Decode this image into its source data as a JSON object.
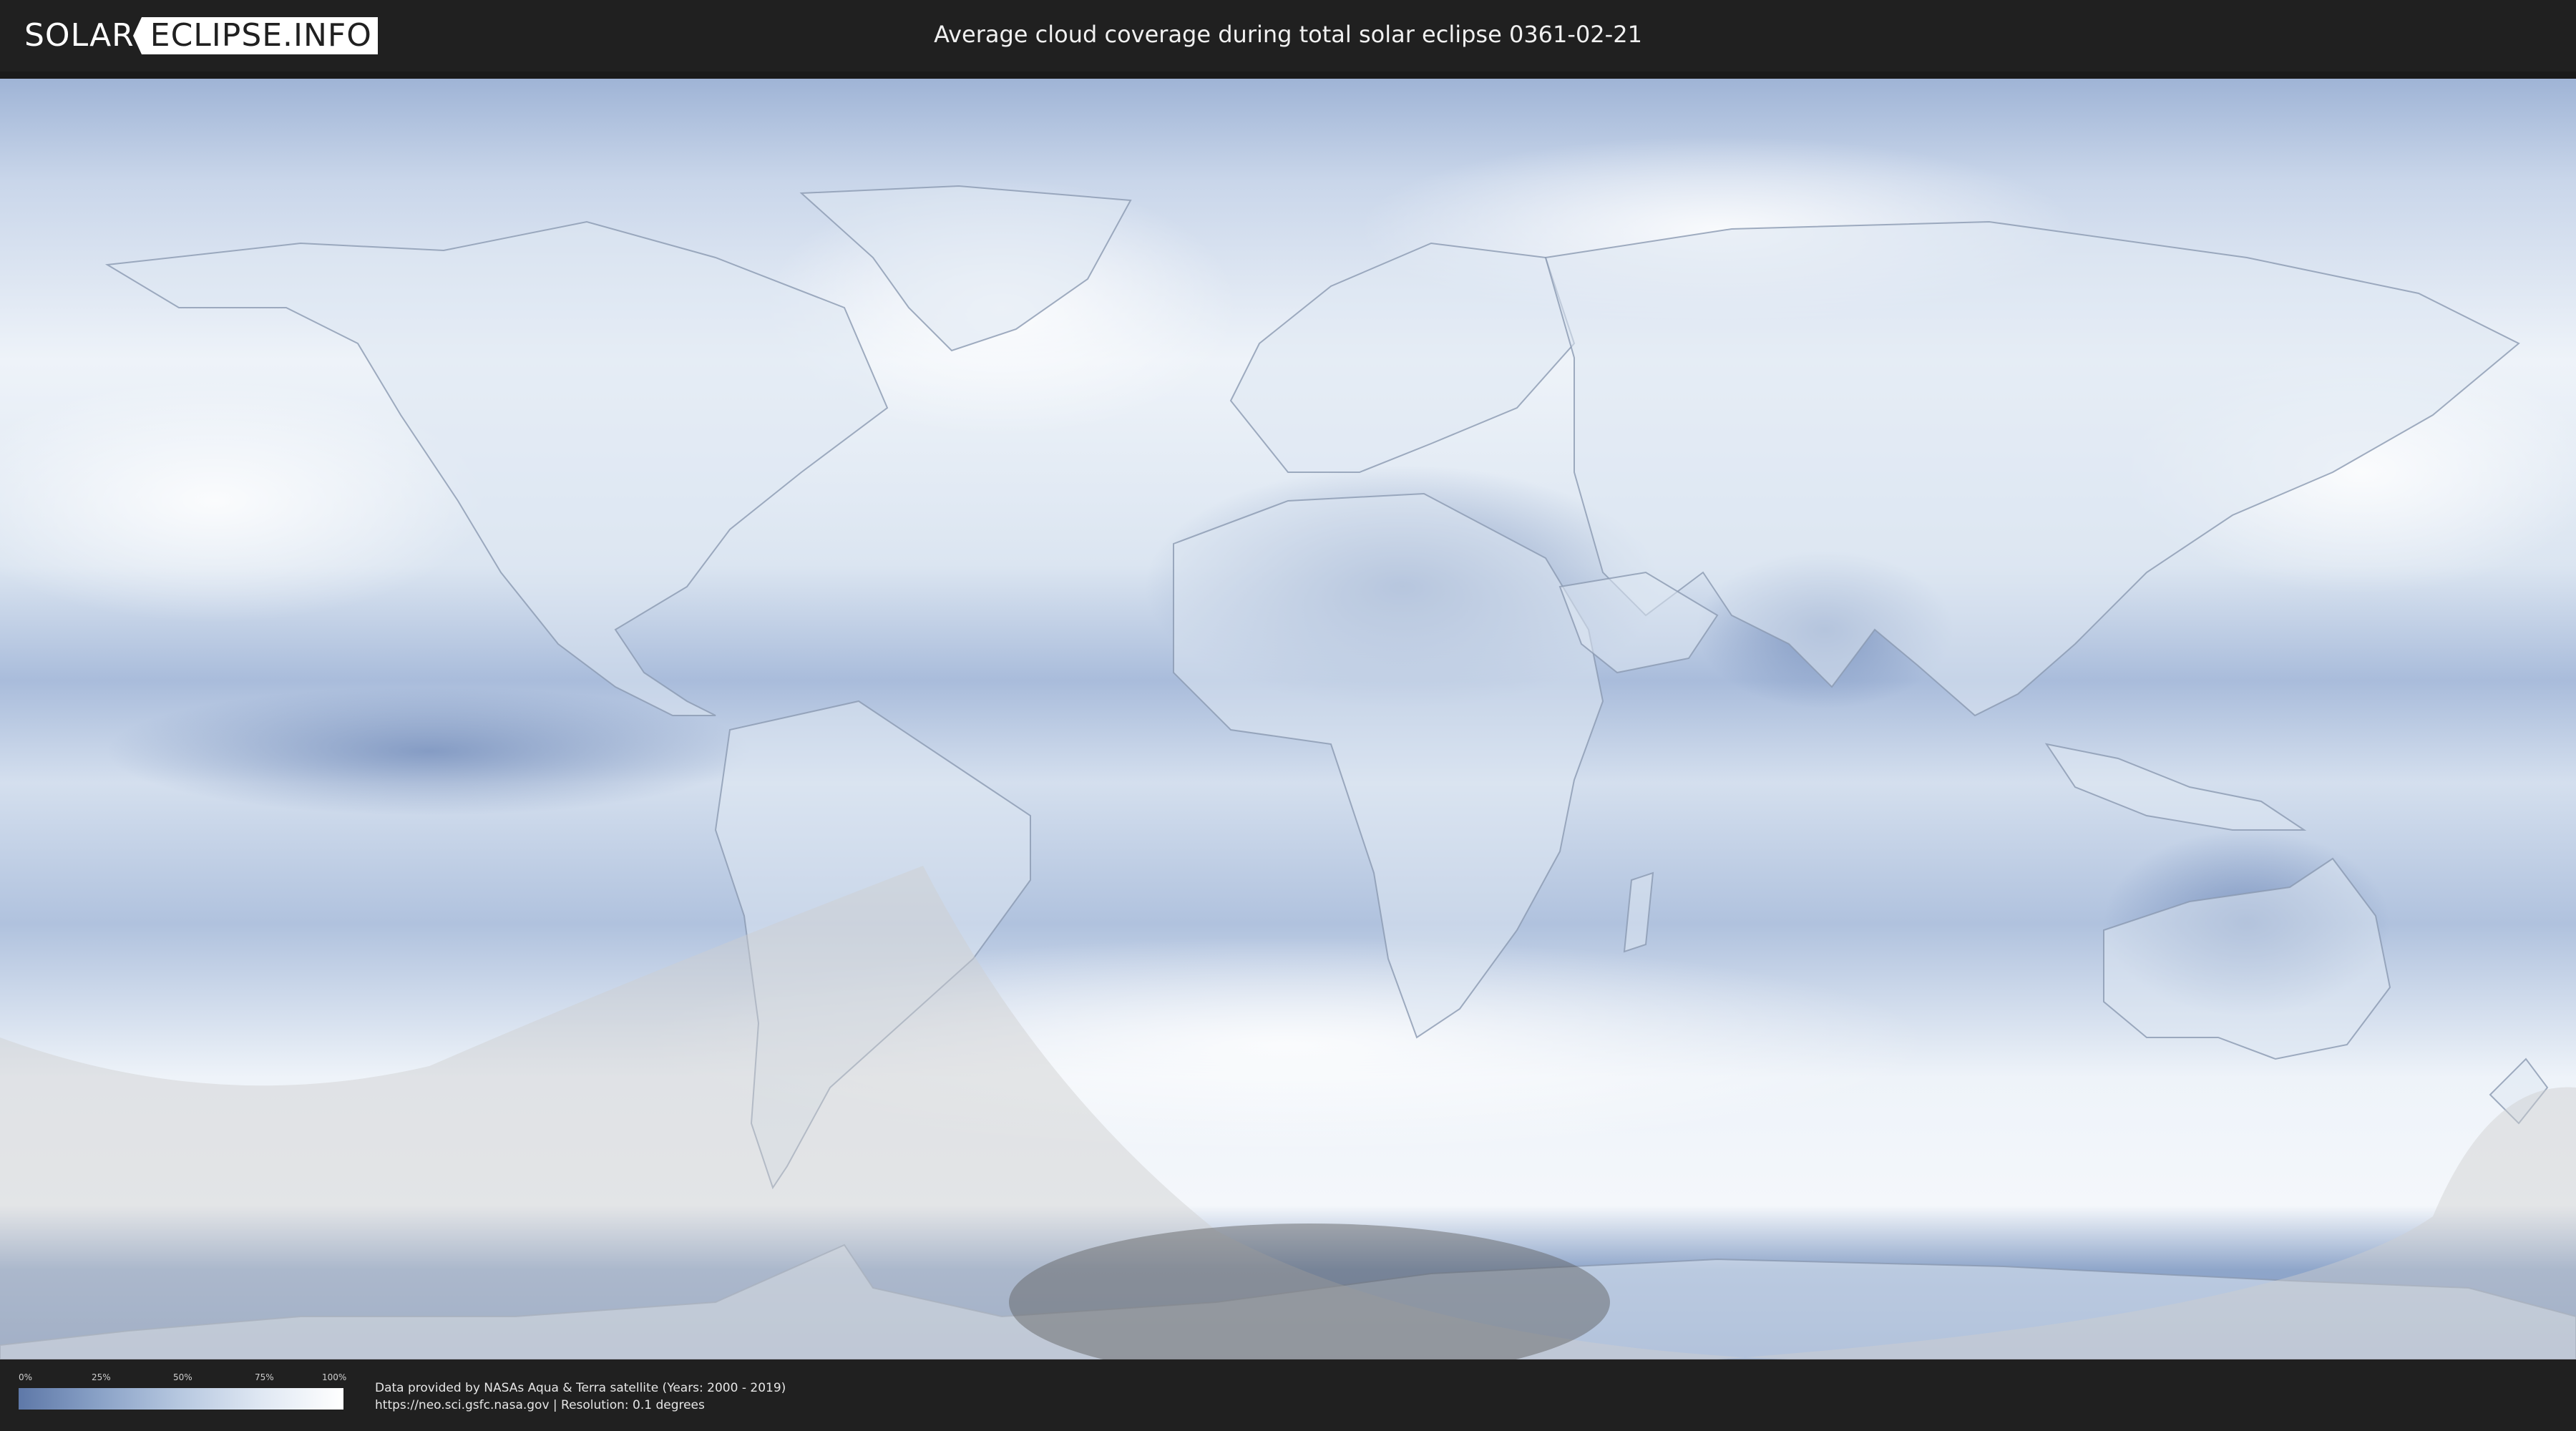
{
  "header": {
    "logo_left": "SOLAR",
    "logo_right": "ECLIPSE.INFO",
    "title": "Average cloud coverage during total solar eclipse 0361-02-21"
  },
  "map": {
    "colors": {
      "ocean_clear": "#6f89b8",
      "cloud_white": "#f4f7fb",
      "land_outline": "#8a98b0",
      "penumbra_shade": "#cfcfcf",
      "umbra_shade": "#5a5a5a"
    }
  },
  "legend": {
    "ticks": [
      "0%",
      "25%",
      "50%",
      "75%",
      "100%"
    ],
    "gradient_start": "#5e78a8",
    "gradient_end": "#ffffff"
  },
  "footer": {
    "credit_line1": "Data provided by NASAs Aqua & Terra satellite (Years: 2000 - 2019)",
    "credit_line2": "https://neo.sci.gsfc.nasa.gov | Resolution: 0.1 degrees"
  }
}
